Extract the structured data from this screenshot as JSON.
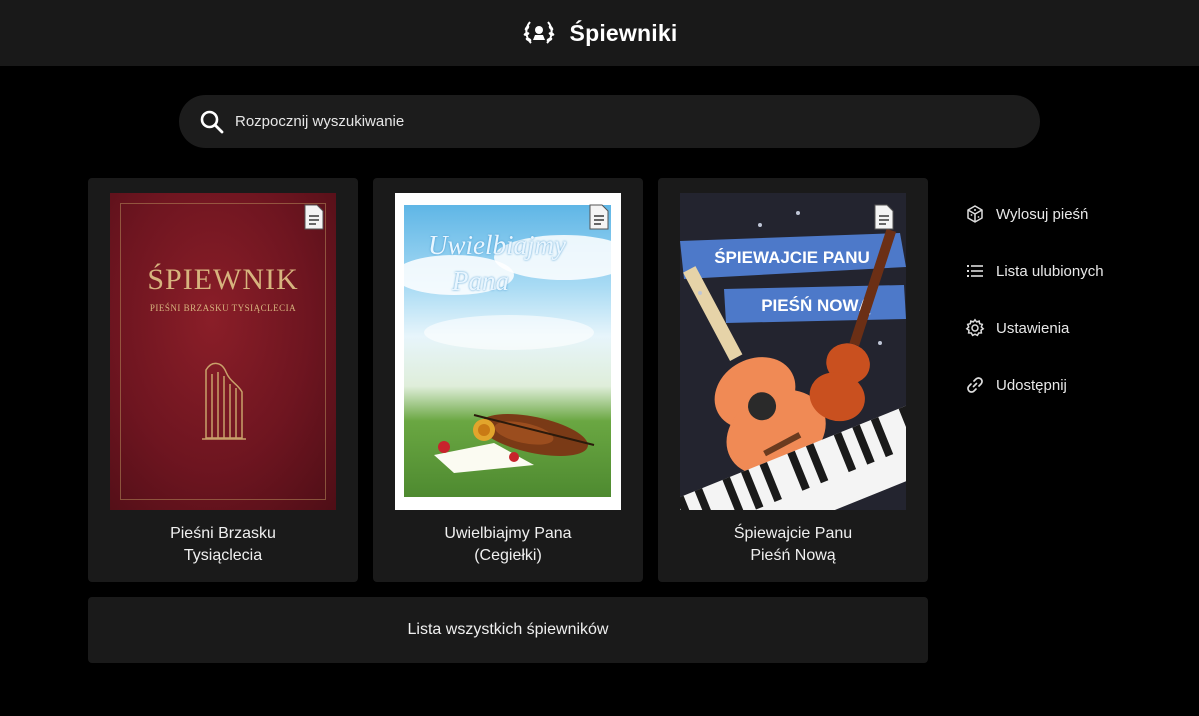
{
  "header": {
    "title": "Śpiewniki",
    "logo_icon": "laurel-wreath-logo"
  },
  "search": {
    "placeholder": "Rozpocznij wyszukiwanie",
    "value": ""
  },
  "books": [
    {
      "title_line1": "Pieśni Brzasku",
      "title_line2": "Tysiąclecia",
      "cover_text": {
        "title": "ŚPIEWNIK",
        "subtitle": "PIEŚNI BRZASKU TYSIĄCLECIA"
      }
    },
    {
      "title_line1": "Uwielbiajmy Pana",
      "title_line2": "(Cegiełki)",
      "cover_text": {
        "title_line1": "Uwielbiajmy",
        "title_line2": "Pana"
      }
    },
    {
      "title_line1": "Śpiewajcie Panu",
      "title_line2": "Pieśń Nową",
      "cover_text": {
        "banner1": "ŚPIEWAJCIE PANU",
        "banner2": "PIEŚŃ NOWĄ"
      }
    }
  ],
  "all_books_label": "Lista wszystkich śpiewników",
  "sidebar": {
    "items": [
      {
        "label": "Wylosuj pieśń",
        "icon": "dice-icon"
      },
      {
        "label": "Lista ulubionych",
        "icon": "list-icon"
      },
      {
        "label": "Ustawienia",
        "icon": "gear-icon"
      },
      {
        "label": "Udostępnij",
        "icon": "link-icon"
      }
    ]
  },
  "colors": {
    "background": "#000000",
    "header": "#191919",
    "card": "#1a1a1a",
    "text": "#f0f0f0"
  }
}
